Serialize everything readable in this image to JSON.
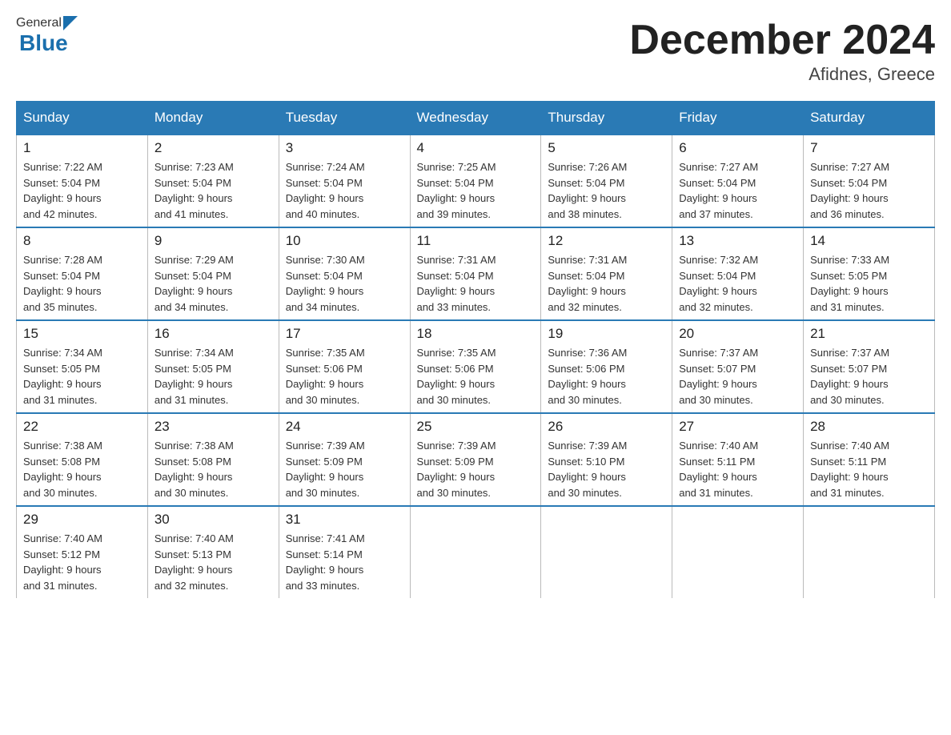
{
  "header": {
    "logo_general": "General",
    "logo_blue": "Blue",
    "month_title": "December 2024",
    "location": "Afidnes, Greece"
  },
  "days_of_week": [
    "Sunday",
    "Monday",
    "Tuesday",
    "Wednesday",
    "Thursday",
    "Friday",
    "Saturday"
  ],
  "weeks": [
    [
      {
        "day": "1",
        "sunrise": "7:22 AM",
        "sunset": "5:04 PM",
        "daylight": "9 hours and 42 minutes."
      },
      {
        "day": "2",
        "sunrise": "7:23 AM",
        "sunset": "5:04 PM",
        "daylight": "9 hours and 41 minutes."
      },
      {
        "day": "3",
        "sunrise": "7:24 AM",
        "sunset": "5:04 PM",
        "daylight": "9 hours and 40 minutes."
      },
      {
        "day": "4",
        "sunrise": "7:25 AM",
        "sunset": "5:04 PM",
        "daylight": "9 hours and 39 minutes."
      },
      {
        "day": "5",
        "sunrise": "7:26 AM",
        "sunset": "5:04 PM",
        "daylight": "9 hours and 38 minutes."
      },
      {
        "day": "6",
        "sunrise": "7:27 AM",
        "sunset": "5:04 PM",
        "daylight": "9 hours and 37 minutes."
      },
      {
        "day": "7",
        "sunrise": "7:27 AM",
        "sunset": "5:04 PM",
        "daylight": "9 hours and 36 minutes."
      }
    ],
    [
      {
        "day": "8",
        "sunrise": "7:28 AM",
        "sunset": "5:04 PM",
        "daylight": "9 hours and 35 minutes."
      },
      {
        "day": "9",
        "sunrise": "7:29 AM",
        "sunset": "5:04 PM",
        "daylight": "9 hours and 34 minutes."
      },
      {
        "day": "10",
        "sunrise": "7:30 AM",
        "sunset": "5:04 PM",
        "daylight": "9 hours and 34 minutes."
      },
      {
        "day": "11",
        "sunrise": "7:31 AM",
        "sunset": "5:04 PM",
        "daylight": "9 hours and 33 minutes."
      },
      {
        "day": "12",
        "sunrise": "7:31 AM",
        "sunset": "5:04 PM",
        "daylight": "9 hours and 32 minutes."
      },
      {
        "day": "13",
        "sunrise": "7:32 AM",
        "sunset": "5:04 PM",
        "daylight": "9 hours and 32 minutes."
      },
      {
        "day": "14",
        "sunrise": "7:33 AM",
        "sunset": "5:05 PM",
        "daylight": "9 hours and 31 minutes."
      }
    ],
    [
      {
        "day": "15",
        "sunrise": "7:34 AM",
        "sunset": "5:05 PM",
        "daylight": "9 hours and 31 minutes."
      },
      {
        "day": "16",
        "sunrise": "7:34 AM",
        "sunset": "5:05 PM",
        "daylight": "9 hours and 31 minutes."
      },
      {
        "day": "17",
        "sunrise": "7:35 AM",
        "sunset": "5:06 PM",
        "daylight": "9 hours and 30 minutes."
      },
      {
        "day": "18",
        "sunrise": "7:35 AM",
        "sunset": "5:06 PM",
        "daylight": "9 hours and 30 minutes."
      },
      {
        "day": "19",
        "sunrise": "7:36 AM",
        "sunset": "5:06 PM",
        "daylight": "9 hours and 30 minutes."
      },
      {
        "day": "20",
        "sunrise": "7:37 AM",
        "sunset": "5:07 PM",
        "daylight": "9 hours and 30 minutes."
      },
      {
        "day": "21",
        "sunrise": "7:37 AM",
        "sunset": "5:07 PM",
        "daylight": "9 hours and 30 minutes."
      }
    ],
    [
      {
        "day": "22",
        "sunrise": "7:38 AM",
        "sunset": "5:08 PM",
        "daylight": "9 hours and 30 minutes."
      },
      {
        "day": "23",
        "sunrise": "7:38 AM",
        "sunset": "5:08 PM",
        "daylight": "9 hours and 30 minutes."
      },
      {
        "day": "24",
        "sunrise": "7:39 AM",
        "sunset": "5:09 PM",
        "daylight": "9 hours and 30 minutes."
      },
      {
        "day": "25",
        "sunrise": "7:39 AM",
        "sunset": "5:09 PM",
        "daylight": "9 hours and 30 minutes."
      },
      {
        "day": "26",
        "sunrise": "7:39 AM",
        "sunset": "5:10 PM",
        "daylight": "9 hours and 30 minutes."
      },
      {
        "day": "27",
        "sunrise": "7:40 AM",
        "sunset": "5:11 PM",
        "daylight": "9 hours and 31 minutes."
      },
      {
        "day": "28",
        "sunrise": "7:40 AM",
        "sunset": "5:11 PM",
        "daylight": "9 hours and 31 minutes."
      }
    ],
    [
      {
        "day": "29",
        "sunrise": "7:40 AM",
        "sunset": "5:12 PM",
        "daylight": "9 hours and 31 minutes."
      },
      {
        "day": "30",
        "sunrise": "7:40 AM",
        "sunset": "5:13 PM",
        "daylight": "9 hours and 32 minutes."
      },
      {
        "day": "31",
        "sunrise": "7:41 AM",
        "sunset": "5:14 PM",
        "daylight": "9 hours and 33 minutes."
      },
      null,
      null,
      null,
      null
    ]
  ],
  "labels": {
    "sunrise": "Sunrise:",
    "sunset": "Sunset:",
    "daylight": "Daylight:"
  }
}
